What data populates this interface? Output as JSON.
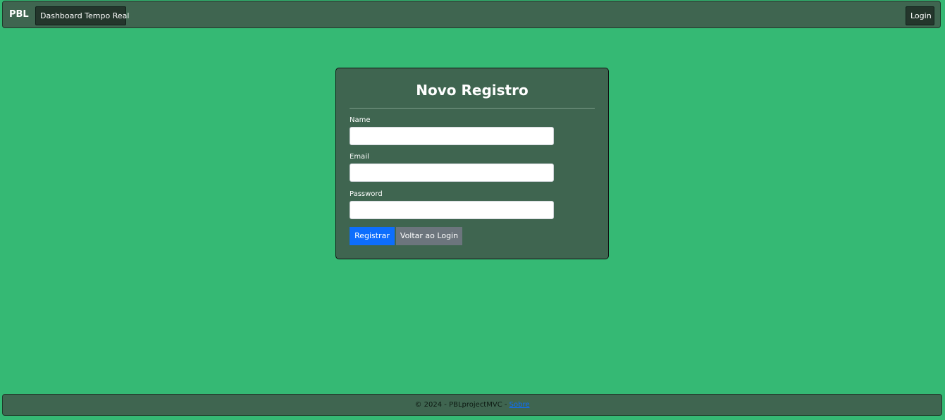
{
  "navbar": {
    "brand": "PBL",
    "dashboard_label": "Dashboard Tempo Real",
    "login_label": "Login"
  },
  "register_form": {
    "title": "Novo Registro",
    "name_label": "Name",
    "name_value": "",
    "email_label": "Email",
    "email_value": "",
    "password_label": "Password",
    "password_value": "",
    "submit_label": "Registrar",
    "back_label": "Voltar ao Login"
  },
  "footer": {
    "copyright": "© 2024 - PBLprojectMVC - ",
    "link_label": "Sobre"
  },
  "colors": {
    "background": "#35b974",
    "panel": "#3f6550",
    "primary": "#0d6efd",
    "secondary": "#6c757d"
  }
}
